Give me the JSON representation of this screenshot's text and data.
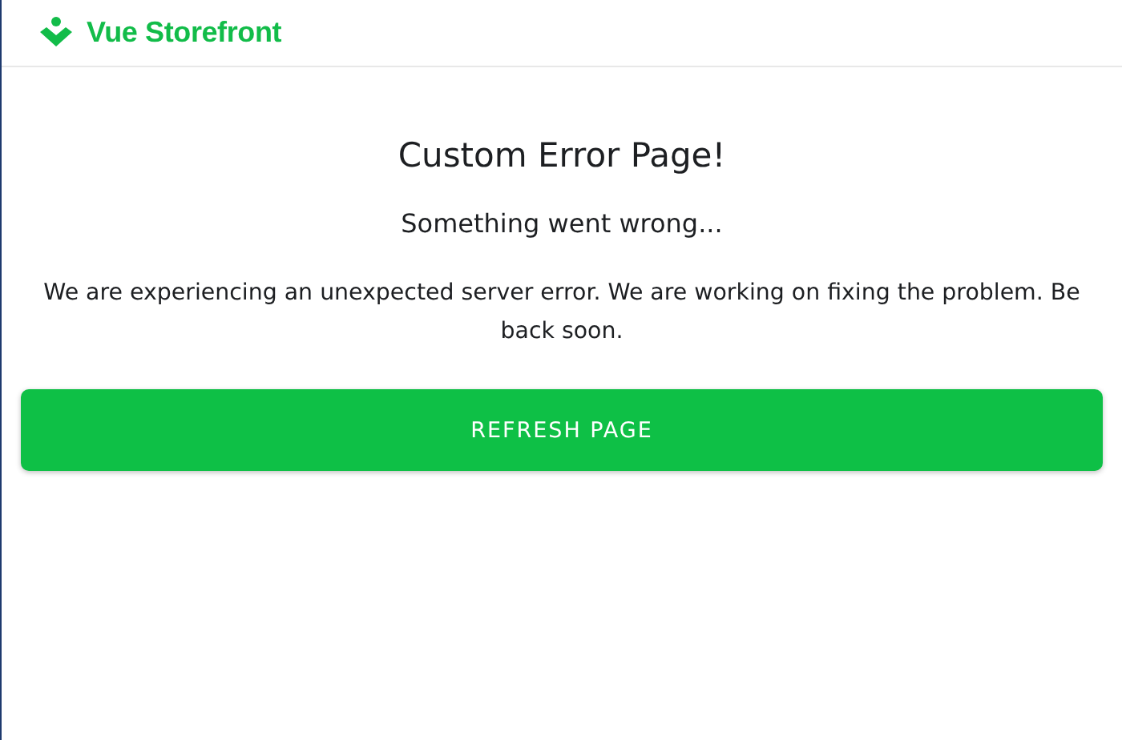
{
  "header": {
    "logo_text": "Vue Storefront"
  },
  "error": {
    "title": "Custom Error Page!",
    "subtitle": "Something went wrong...",
    "message": "We are experiencing an unexpected server error. We are working on fixing the problem. Be back soon."
  },
  "button": {
    "label": "REFRESH PAGE"
  }
}
